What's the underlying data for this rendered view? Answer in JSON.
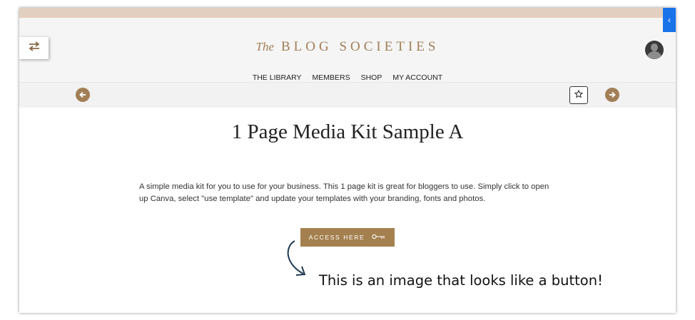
{
  "header": {
    "logo_script": "The",
    "logo_text": "BLOG SOCIETIES",
    "nav": [
      "THE LIBRARY",
      "MEMBERS",
      "SHOP",
      "MY ACCOUNT"
    ]
  },
  "icons": {
    "swap": "swap-arrows-icon",
    "prev": "arrow-left-circle-icon",
    "next": "arrow-right-circle-icon",
    "favorite": "star-outline-icon",
    "avatar": "user-avatar-icon",
    "collapse": "chevron-left-icon",
    "key": "key-icon"
  },
  "colors": {
    "accent": "#a27e56",
    "top_stripe": "#e3cfc0",
    "button_bg": "#a5804f",
    "blue_tab": "#1a73e8"
  },
  "content": {
    "title": "1 Page Media Kit Sample A",
    "description_line1": "A simple media kit for you to use for your business. This 1 page kit is great for bloggers to use. Simply click to open",
    "description_line2": "up Canva, select \"use template\" and update your templates with your branding, fonts and photos.",
    "access_label": "ACCESS HERE"
  },
  "annotation": {
    "text": "This is an image that looks like a button!"
  }
}
